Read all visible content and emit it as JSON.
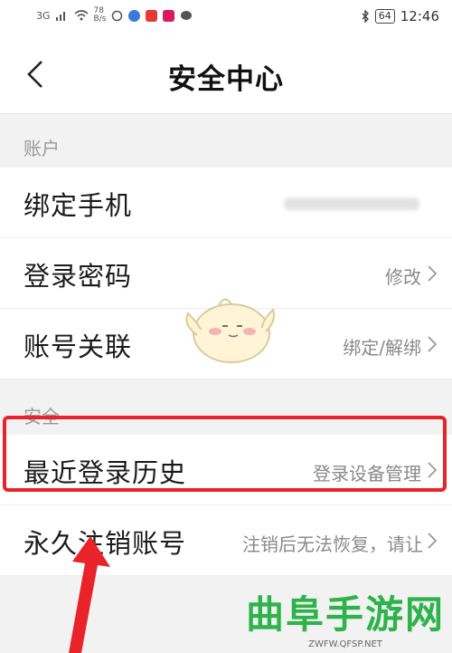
{
  "status_bar": {
    "network": "3G",
    "speed_value": "78",
    "speed_unit": "B/s",
    "battery": "64",
    "time": "12:46"
  },
  "header": {
    "title": "安全中心"
  },
  "sections": [
    {
      "label": "账户"
    },
    {
      "label": "安全"
    }
  ],
  "rows": {
    "bind_phone": {
      "label": "绑定手机"
    },
    "login_password": {
      "label": "登录密码",
      "value": "修改"
    },
    "account_link": {
      "label": "账号关联",
      "value": "绑定/解绑"
    },
    "recent_login": {
      "label": "最近登录历史",
      "value": "登录设备管理"
    },
    "cancel_account": {
      "label": "永久注销账号",
      "value": "注销后无法恢复，请让"
    }
  },
  "watermark": {
    "text": "曲阜手游网",
    "url": "ZWFW.QFSP.NET"
  },
  "colors": {
    "highlight": "#e8232a",
    "arrow": "#e8232a",
    "watermark": "#2db34a"
  }
}
